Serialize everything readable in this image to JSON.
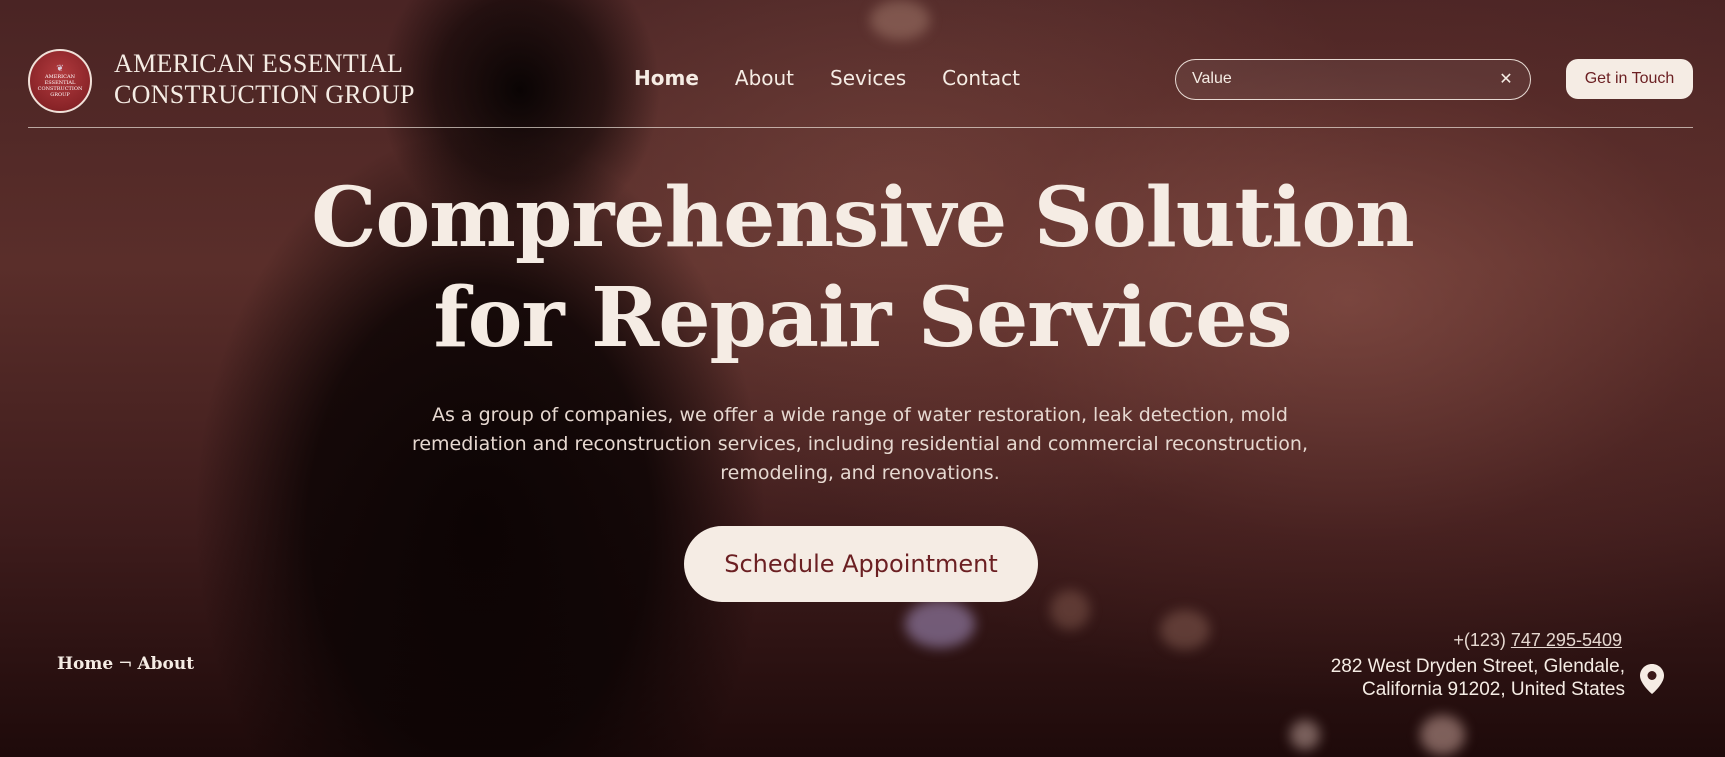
{
  "brand": {
    "logo_lines": [
      "AMERICAN",
      "ESSENTIAL",
      "CONSTRUCTION",
      "GROUP"
    ],
    "name_line1": "AMERICAN ESSENTIAL",
    "name_line2": "CONSTRUCTION GROUP"
  },
  "nav": {
    "items": [
      {
        "label": "Home",
        "active": true
      },
      {
        "label": "About",
        "active": false
      },
      {
        "label": "Sevices",
        "active": false
      },
      {
        "label": "Contact",
        "active": false
      }
    ]
  },
  "search": {
    "value": "Value",
    "clear_icon": "close-icon"
  },
  "header_cta": {
    "label": "Get in Touch"
  },
  "hero": {
    "title_line1": "Comprehensive Solution",
    "title_line2": "for Repair Services",
    "subtitle": "As a group of companies, we offer a wide range of water restoration, leak detection, mold remediation and reconstruction services, including residential and commercial reconstruction, remodeling, and renovations.",
    "cta": "Schedule Appointment"
  },
  "breadcrumb": {
    "items": [
      "Home",
      "About"
    ],
    "separator": "¬"
  },
  "contact": {
    "phone_prefix": "+(123) ",
    "phone_number": "747 295-5409",
    "address_line1": "282 West Dryden Street, Glendale,",
    "address_line2": "California 91202, United States",
    "address_icon": "map-pin-icon"
  },
  "colors": {
    "accent_cream": "#f5ece4",
    "brand_maroon": "#6b1f22"
  }
}
